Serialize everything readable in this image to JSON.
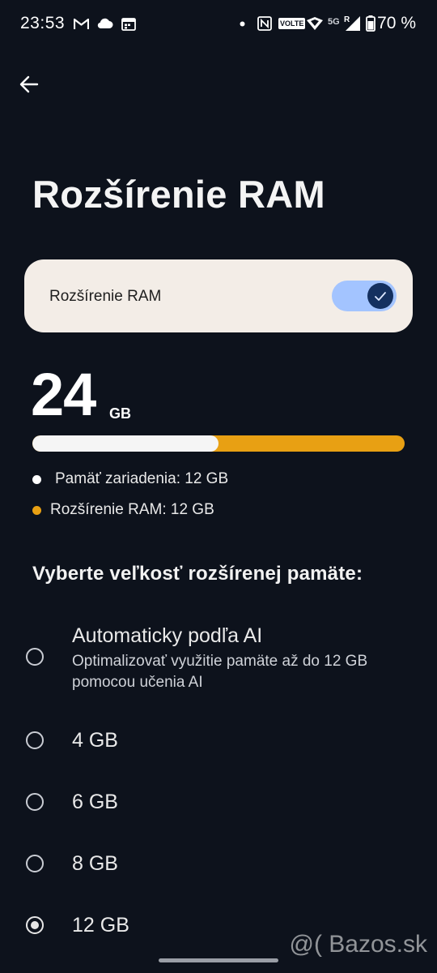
{
  "status_bar": {
    "time": "23:53",
    "battery": "70 %",
    "network_label": "5G",
    "volte_label": "VOLTE",
    "roaming_label": "R",
    "icons": [
      "gmail-icon",
      "cloud-icon",
      "calendar-icon",
      "dot-icon",
      "nfc-icon",
      "volte-icon",
      "hotspot-icon",
      "signal-icon",
      "battery-icon"
    ]
  },
  "header": {
    "back_icon": "back-arrow-icon",
    "title": "Rozšírenie RAM"
  },
  "toggle_card": {
    "label": "Rozšírenie RAM",
    "enabled": true,
    "accent_color": "#a3c4ff",
    "thumb_color": "#14305f"
  },
  "summary": {
    "total_value": "24",
    "total_unit": "GB",
    "device_fraction": 0.5,
    "device_color": "#f5f5f5",
    "extension_color": "#e8a013"
  },
  "legend": [
    {
      "label": "Pamäť zariadenia: 12 GB",
      "color": "#ffffff"
    },
    {
      "label": "Rozšírenie RAM: 12 GB",
      "color": "#e8a013"
    }
  ],
  "options_section": {
    "heading": "Vyberte veľkosť rozšírenej pamäte:",
    "options": [
      {
        "label": "Automaticky podľa AI",
        "description": "Optimalizovať využitie pamäte až do 12 GB pomocou učenia AI",
        "selected": false
      },
      {
        "label": "4 GB",
        "selected": false
      },
      {
        "label": "6 GB",
        "selected": false
      },
      {
        "label": "8 GB",
        "selected": false
      },
      {
        "label": "12 GB",
        "selected": true
      }
    ]
  },
  "watermark": "@( Bazos.sk"
}
